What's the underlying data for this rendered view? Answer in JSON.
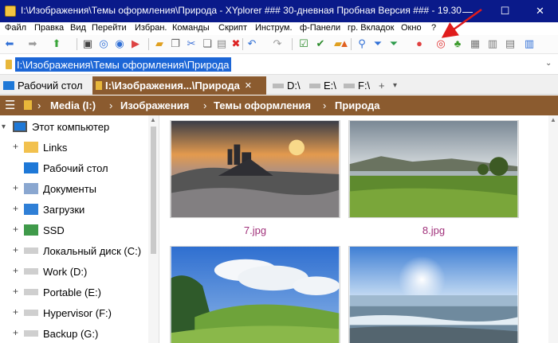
{
  "window": {
    "title": "I:\\Изображения\\Темы оформления\\Природа - XYplorer ### 30-дневная Пробная Версия ### - 19.30",
    "controls": {
      "minimize": "—",
      "maximize": "☐",
      "close": "✕"
    },
    "titlebar_color": "#0a1a8a"
  },
  "menu": [
    "Файл",
    "Правка",
    "Вид",
    "Перейти",
    "Избран.",
    "Команды",
    "Скрипт",
    "Инструм.",
    "ф-Панели",
    "гр. Вкладок",
    "Окно",
    "?"
  ],
  "toolbar": {
    "icons": [
      "back-arrow-icon",
      "forward-arrow-icon",
      "up-arrow-icon",
      "computer-icon",
      "target-icon",
      "target-icon",
      "play-icon",
      "new-folder-icon",
      "copy-icon",
      "cut-icon",
      "copy-to-icon",
      "paste-icon",
      "delete-icon",
      "undo-icon",
      "redo-icon",
      "checkbox-icon",
      "checkmark-icon",
      "folder-icon",
      "delete-icon",
      "search-icon",
      "filter-icon",
      "filter-icon",
      "color-filter-icon",
      "hypnotic-target-icon",
      "tree-icon",
      "grid-icon",
      "panel-icon",
      "panel-icon",
      "columns-icon"
    ]
  },
  "address": {
    "path": "I:\\Изображения\\Темы оформления\\Природа",
    "dropdown": "⌄"
  },
  "tabs": [
    {
      "label": "Рабочий стол",
      "active": false
    },
    {
      "label": "I:\\Изображения...\\Природа",
      "active": true,
      "close": "✕"
    },
    {
      "label": "D:\\",
      "active": false
    },
    {
      "label": "E:\\",
      "active": false
    },
    {
      "label": "F:\\",
      "active": false
    },
    {
      "label": "+",
      "active": false
    },
    {
      "label": "▾",
      "active": false
    }
  ],
  "breadcrumb": {
    "menu_glyph": "☰",
    "items": [
      "Media (I:)",
      "Изображения",
      "Темы оформления",
      "Природа"
    ],
    "separator": "›",
    "color": "#8b5b2f"
  },
  "tree": {
    "root": "Этот компьютер",
    "items": [
      {
        "label": "Links",
        "icon": "folder-icon"
      },
      {
        "label": "Рабочий стол",
        "icon": "desktop-icon"
      },
      {
        "label": "Документы",
        "icon": "documents-icon"
      },
      {
        "label": "Загрузки",
        "icon": "downloads-icon"
      },
      {
        "label": "SSD",
        "icon": "user-folder-icon"
      },
      {
        "label": "Локальный диск (C:)",
        "icon": "drive-icon"
      },
      {
        "label": "Work (D:)",
        "icon": "drive-icon"
      },
      {
        "label": "Portable (E:)",
        "icon": "drive-icon"
      },
      {
        "label": "Hypervisor (F:)",
        "icon": "drive-icon"
      },
      {
        "label": "Backup (G:)",
        "icon": "drive-icon"
      }
    ],
    "expander": "+"
  },
  "thumbnails": [
    {
      "label": "7.jpg",
      "scene": "foggy-castle-sunrise"
    },
    {
      "label": "8.jpg",
      "scene": "green-meadow-lake"
    },
    {
      "label": "",
      "scene": "green-hills-clouds"
    },
    {
      "label": "",
      "scene": "sunny-sea-shore"
    }
  ],
  "scrollbar": {
    "up": "▲"
  }
}
